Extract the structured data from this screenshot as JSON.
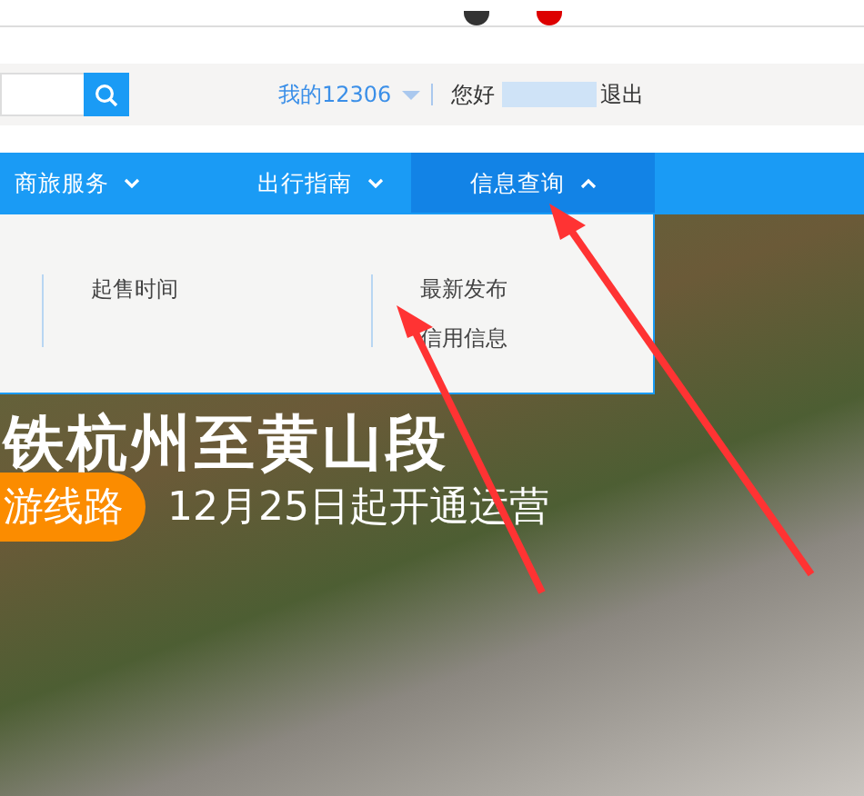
{
  "header": {
    "my_account": "我的12306",
    "greeting": "您好",
    "logout": "退出"
  },
  "nav": [
    {
      "label": "商旅服务",
      "selected": false
    },
    {
      "label": "出行指南",
      "selected": false
    },
    {
      "label": "信息查询",
      "selected": true
    }
  ],
  "dropdown": {
    "columns": [
      [
        "起售时间"
      ],
      [
        "最新发布",
        "信用信息"
      ]
    ]
  },
  "banner": {
    "headline": "铁杭州至黄山段",
    "tag": "游线路",
    "subtitle": "12月25日起开通运营"
  }
}
